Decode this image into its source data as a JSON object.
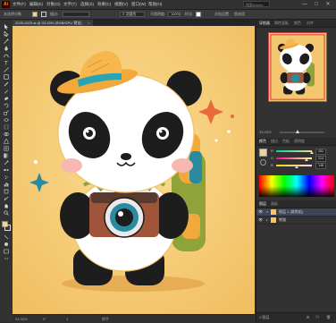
{
  "app": {
    "logo": "Ai"
  },
  "menus": [
    "文件(F)",
    "编辑(E)",
    "对象(O)",
    "文字(T)",
    "选择(S)",
    "效果(C)",
    "视图(V)",
    "窗口(W)",
    "帮助(H)"
  ],
  "title_search": {
    "label": "搜索Adobe Stock",
    "placeholder": ""
  },
  "window_controls": {
    "minimize": "—",
    "maximize": "□",
    "close": "✕"
  },
  "options_bar": {
    "object_label": "未选择对象",
    "stroke_label": "描边:",
    "stroke_value": "",
    "brush_value": "3 点圆形",
    "opacity_label": "不透明度:",
    "opacity_value": "100%",
    "style_label": "样式:",
    "doc_setup_label": "文档设置",
    "prefs_label": "首选项"
  },
  "document_tab": {
    "title": "2025-0225.ai @ 33.33% (RGB/GPU 预览)",
    "close": "×"
  },
  "status_bar": {
    "zoom": "33.33%",
    "angle": "0°",
    "artboard_num": "1",
    "tool": "抓手"
  },
  "panel_tabs_top": [
    "导航器",
    "属性面板",
    "颜色",
    "对齐"
  ],
  "navigator": {
    "zoom": "33.33%"
  },
  "panel_tabs_color": [
    "颜色",
    "描边",
    "色板",
    "透明度"
  ],
  "color_panel": {
    "r_label": "R",
    "g_label": "G",
    "b_label": "B",
    "r_value": "252",
    "g_value": "214",
    "b_value": "148",
    "fill_color": "#f6cf8b"
  },
  "panel_tabs_layers": [
    "图层",
    "画板"
  ],
  "layers": [
    {
      "name": "图层 1 (裁剪组)",
      "selected": true
    },
    {
      "name": "熊猫",
      "selected": false
    }
  ],
  "layers_footer": {
    "count": "2 图层"
  },
  "colors": {
    "artboard_bg": "#f3c770",
    "panda_white": "#ffffff",
    "panda_black": "#1d1d1d",
    "hat": "#f2a93b",
    "hat_band": "#2aa3b5",
    "camera_body": "#a0553a",
    "backpack": "#8fa33a",
    "accent_red": "#e9683c",
    "sparkle_teal": "#2a8aa0"
  }
}
